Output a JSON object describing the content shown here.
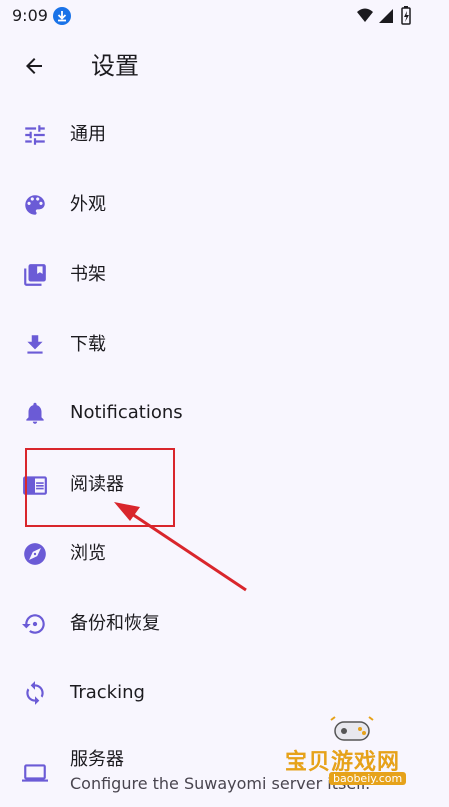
{
  "status_bar": {
    "time": "9:09"
  },
  "header": {
    "title": "设置"
  },
  "menu": {
    "items": [
      {
        "label": "通用",
        "icon": "tune-icon"
      },
      {
        "label": "外观",
        "icon": "palette-icon"
      },
      {
        "label": "书架",
        "icon": "library-books-icon"
      },
      {
        "label": "下载",
        "icon": "download-icon"
      },
      {
        "label": "Notifications",
        "icon": "bell-icon"
      },
      {
        "label": "阅读器",
        "icon": "chrome-reader-mode-icon"
      },
      {
        "label": "浏览",
        "icon": "compass-icon"
      },
      {
        "label": "备份和恢复",
        "icon": "settings-backup-restore-icon"
      },
      {
        "label": "Tracking",
        "icon": "sync-icon"
      },
      {
        "label": "服务器",
        "sublabel": "Configure the Suwayomi server itself.",
        "icon": "computer-icon"
      }
    ]
  },
  "watermark": {
    "text": "宝贝游戏网",
    "url": "baobeiy.com"
  },
  "colors": {
    "accent": "#6b5bd6",
    "background": "#f8f6fe",
    "highlight": "#d9262c"
  }
}
